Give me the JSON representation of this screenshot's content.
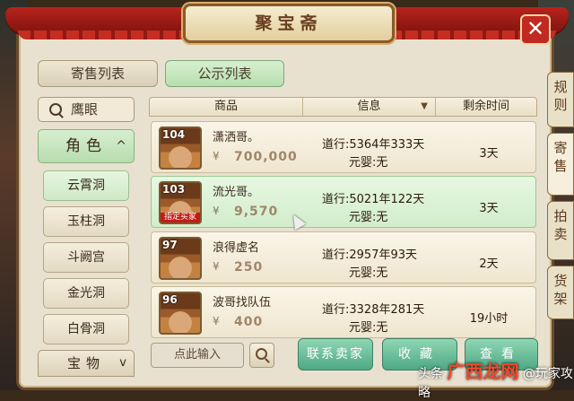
{
  "window": {
    "title": "聚宝斋",
    "close_label": "✕"
  },
  "tabs": {
    "consign": "寄售列表",
    "public": "公示列表"
  },
  "side_tabs": [
    "规则",
    "寄售",
    "拍卖",
    "货架"
  ],
  "left_panel": {
    "search_label": "鹰眼",
    "category_role": "角色",
    "category_role_chevron": "^",
    "sub_items": [
      "云霄洞",
      "玉柱洞",
      "斗阙宫",
      "金光洞",
      "白骨洞"
    ],
    "active_sub_index": 0,
    "category_treasure": "宝物",
    "category_treasure_chevron": "v"
  },
  "table": {
    "headers": {
      "goods": "商品",
      "info": "信息",
      "time": "剩余时间",
      "sort_icon": "▼"
    },
    "rows": [
      {
        "level": "104",
        "name": "潇洒哥。",
        "currency_icon": "¥",
        "price": "700,000",
        "daoxing": "道行:5364年333天",
        "yuanying": "元婴:无",
        "time": "3天",
        "tag": ""
      },
      {
        "level": "103",
        "name": "流光哥。",
        "currency_icon": "¥",
        "price": "9,570",
        "daoxing": "道行:5021年122天",
        "yuanying": "元婴:无",
        "time": "3天",
        "tag": "指定买家"
      },
      {
        "level": "97",
        "name": "浪得虚名",
        "currency_icon": "¥",
        "price": "250",
        "daoxing": "道行:2957年93天",
        "yuanying": "元婴:无",
        "time": "2天",
        "tag": ""
      },
      {
        "level": "96",
        "name": "波哥找队伍",
        "currency_icon": "¥",
        "price": "400",
        "daoxing": "道行:3328年281天",
        "yuanying": "元婴:无",
        "time": "19小时",
        "tag": ""
      }
    ],
    "highlighted_row_index": 1
  },
  "bottom": {
    "input_placeholder": "点此输入",
    "contact_label": "联系卖家",
    "collect_label": "收藏",
    "view_label": "查看"
  },
  "watermark": {
    "prefix": "头条",
    "brand": "广西龙网",
    "suffix": "@玩家攻略"
  },
  "icons": {
    "search": "search-icon",
    "close": "close-icon",
    "cursor": "mouse-cursor-icon"
  },
  "colors": {
    "accent_green": "#b6dfae",
    "title_red": "#b8231b",
    "price_gray": "#a0866a"
  }
}
